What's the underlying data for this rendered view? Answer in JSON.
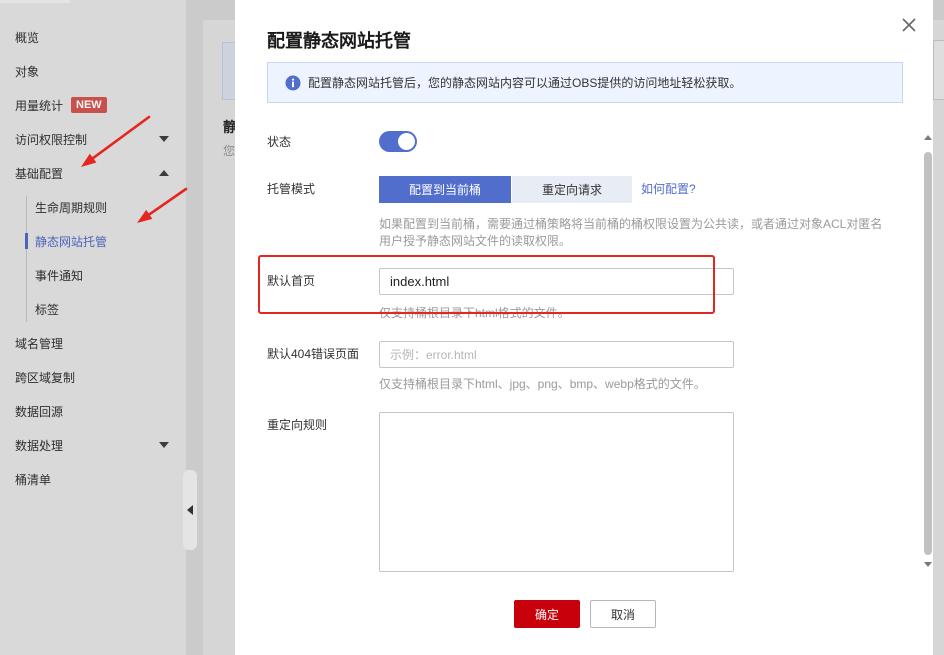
{
  "sidebar": {
    "items": [
      {
        "label": "概览"
      },
      {
        "label": "对象"
      },
      {
        "label": "用量统计",
        "badge": "NEW"
      },
      {
        "label": "访问权限控制",
        "icon": "caret-down-icon"
      },
      {
        "label": "基础配置",
        "icon": "caret-up-icon"
      },
      {
        "label": "生命周期规则"
      },
      {
        "label": "静态网站托管",
        "active": true
      },
      {
        "label": "事件通知"
      },
      {
        "label": "标签"
      },
      {
        "label": "域名管理"
      },
      {
        "label": "跨区域复制"
      },
      {
        "label": "数据回源"
      },
      {
        "label": "数据处理",
        "icon": "caret-down-icon"
      },
      {
        "label": "桶清单"
      }
    ],
    "collapse_icon": "chevron-left-icon"
  },
  "background_page": {
    "heading_fragment": "静",
    "description_fragment": "您"
  },
  "dialog": {
    "title": "配置静态网站托管",
    "close_icon": "close-icon",
    "info": {
      "icon": "info-icon",
      "text": "配置静态网站托管后，您的静态网站内容可以通过OBS提供的访问地址轻松获取。"
    },
    "status": {
      "label": "状态",
      "enabled": true
    },
    "hosting_mode": {
      "label": "托管模式",
      "options": [
        "配置到当前桶",
        "重定向请求"
      ],
      "selected_index": 0,
      "help_link": "如何配置?",
      "hint_lines": [
        "如果配置到当前桶，需要通过桶策略将当前桶的桶权限设置为公共读，或者通过对象ACL对匿名",
        "用户授予静态网站文件的读取权限。"
      ]
    },
    "index_document": {
      "label": "默认首页",
      "value": "index.html",
      "hint": "仅支持桶根目录下html格式的文件。"
    },
    "error_document": {
      "label": "默认404错误页面",
      "placeholder": "示例：error.html",
      "hint": "仅支持桶根目录下html、jpg、png、bmp、webp格式的文件。"
    },
    "redirect_rules": {
      "label": "重定向规则"
    },
    "buttons": {
      "confirm": "确定",
      "cancel": "取消"
    }
  },
  "colors": {
    "primary": "#526ecc",
    "danger": "#c7000b",
    "annotation": "#e3261f",
    "badge": "#c9514c",
    "nav_active": "#4b64b9",
    "info_bg": "#edf3ff",
    "info_border": "#c6d6f3"
  }
}
